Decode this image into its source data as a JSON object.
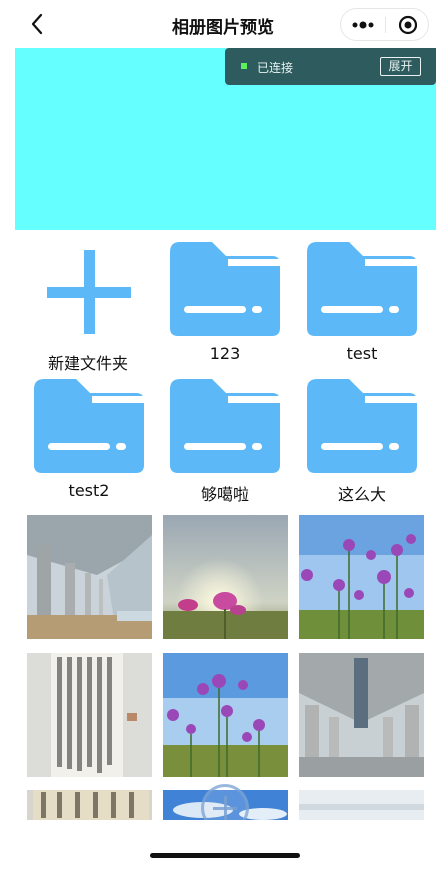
{
  "nav": {
    "title": "相册图片预览",
    "back_icon": "chevron-left-icon",
    "more_icon": "more-dots-icon",
    "close_icon": "target-close-icon"
  },
  "connection": {
    "status": "已连接",
    "expand_label": "展开",
    "dot_color": "#5df05d"
  },
  "banner": {
    "color": "#66ffff"
  },
  "folders": [
    {
      "label": "新建文件夹",
      "icon": "plus-icon"
    },
    {
      "label": "123",
      "icon": "folder-icon"
    },
    {
      "label": "test",
      "icon": "folder-icon"
    },
    {
      "label": "test2",
      "icon": "folder-icon"
    },
    {
      "label": "够噶啦",
      "icon": "folder-icon"
    },
    {
      "label": "这么大",
      "icon": "folder-icon"
    }
  ],
  "accent_color": "#5cb8f7",
  "photos": [
    {
      "subject": "bridge-underside"
    },
    {
      "subject": "sunset-cosmos-flower"
    },
    {
      "subject": "cosmos-flowers-sky"
    },
    {
      "subject": "calligraphy-scroll"
    },
    {
      "subject": "cosmos-flowers-sky"
    },
    {
      "subject": "bridge-underside"
    },
    {
      "subject": "calligraphy-scroll"
    },
    {
      "subject": "blue-sky"
    },
    {
      "subject": "bridge-underside"
    }
  ],
  "fab_icon": "add-circle-icon"
}
